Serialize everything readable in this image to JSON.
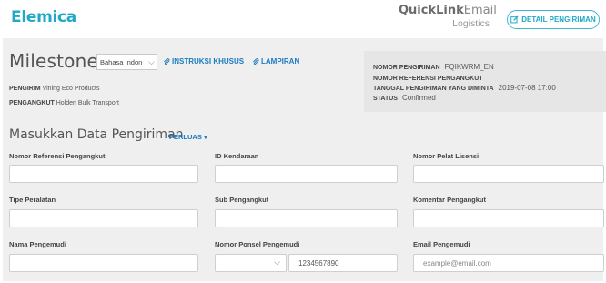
{
  "header": {
    "brand": "Elemica",
    "product_bold": "QuickLink",
    "product_light": "Email",
    "product_sub": "Logistics",
    "detail_button": "DETAIL PENGIRIMAN"
  },
  "milestone": {
    "title": "Milestone",
    "language_value": "Bahasa Indon",
    "link_instructions": "INSTRUKSI KHUSUS",
    "link_attachments": "LAMPIRAN",
    "shipper_label": "PENGIRIM",
    "shipper_value": "Vining Eco Products",
    "carrier_label": "PENGANGKUT",
    "carrier_value": "Holden Bulk Transport"
  },
  "info": {
    "shipment_no_label": "NOMOR PENGIRIMAN",
    "shipment_no_value": "FQIKWRM_EN",
    "carrier_ref_label": "NOMOR REFERENSI PENGANGKUT",
    "carrier_ref_value": "",
    "requested_date_label": "TANGGAL PENGIRIMAN YANG DIMINTA",
    "requested_date_value": "2019-07-08 17:00",
    "status_label": "STATUS",
    "status_value": "Confirmed"
  },
  "form": {
    "section_title": "Masukkan Data Pengiriman",
    "expand_label": "PERLUAS",
    "carrier_ref_label": "Nomor Referensi Pengangkut",
    "carrier_ref_value": "",
    "vehicle_id_label": "ID Kendaraan",
    "vehicle_id_value": "",
    "license_plate_label": "Nomor Pelat Lisensi",
    "license_plate_value": "",
    "equipment_type_label": "Tipe Peralatan",
    "equipment_type_value": "",
    "sub_carrier_label": "Sub Pengangkut",
    "sub_carrier_value": "",
    "carrier_comment_label": "Komentar Pengangkut",
    "carrier_comment_value": "",
    "driver_name_label": "Nama Pengemudi",
    "driver_name_value": "",
    "driver_phone_label": "Nomor Ponsel Pengemudi",
    "driver_phone_code": "",
    "driver_phone_value": "1234567890",
    "driver_email_label": "Email Pengemudi",
    "driver_email_placeholder": "example@email.com"
  },
  "colors": {
    "brand": "#1fa9c6",
    "link": "#1a7bbf",
    "panel": "#efefef",
    "info_box": "#e6e6e6"
  },
  "icons": {
    "detail": "edit-square-icon",
    "attachment": "paperclip-icon",
    "dropdown": "chevron-down-icon"
  }
}
